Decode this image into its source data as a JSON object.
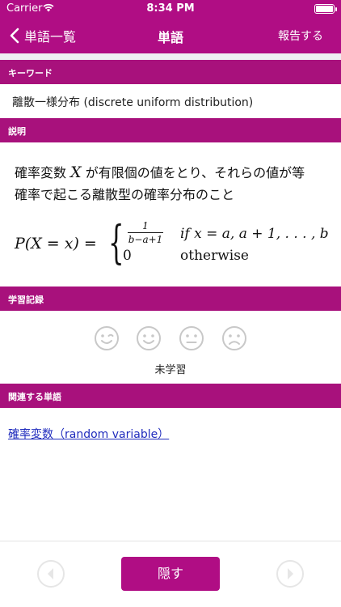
{
  "status_bar": {
    "carrier": "Carrier",
    "time": "8:34 PM"
  },
  "nav": {
    "back_label": "単語一覧",
    "title": "単語",
    "report_label": "報告する"
  },
  "keyword": {
    "header": "キーワード",
    "text": "離散一様分布 (discrete uniform distribution)"
  },
  "description": {
    "header": "説明",
    "line1_pre": "確率変数 ",
    "line1_var": "X",
    "line1_post": " が有限個の値をとり、それらの値が等",
    "line2": "確率で起こる離散型の確率分布のこと",
    "formula": {
      "lhs": "P(X = x) =",
      "frac_num": "1",
      "frac_den": "b−a+1",
      "zero": "0",
      "cond1": "if x = a, a + 1, . . . , b",
      "cond2": "otherwise"
    }
  },
  "study": {
    "header": "学習記録",
    "faces": [
      "wink-face-icon",
      "smile-face-icon",
      "neutral-face-icon",
      "sad-face-icon"
    ],
    "status": "未学習"
  },
  "related": {
    "header": "関連する単語",
    "link": "確率変数（random variable）"
  },
  "bottom": {
    "hide_label": "隠す"
  },
  "colors": {
    "accent": "#b00d84",
    "section_header": "#a8117c",
    "link": "#1f2bbd"
  }
}
